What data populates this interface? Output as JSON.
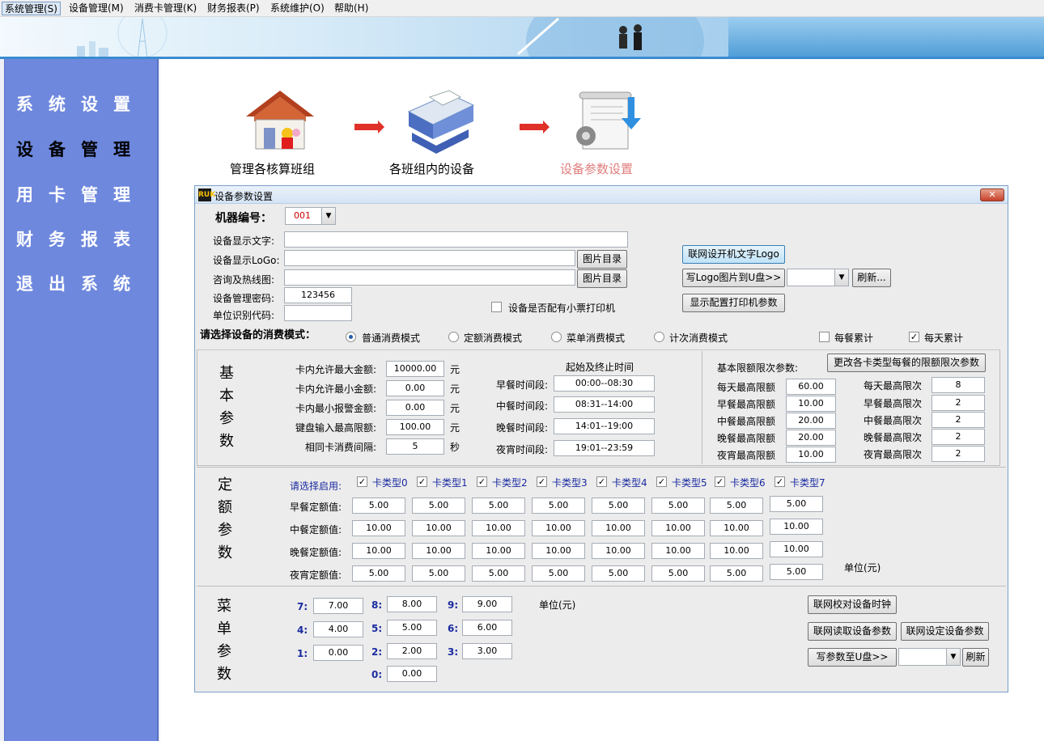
{
  "menu": [
    "系统管理(S)",
    "设备管理(M)",
    "消费卡管理(K)",
    "财务报表(P)",
    "系统维护(O)",
    "帮助(H)"
  ],
  "sidebar": [
    "系统设置",
    "设备管理",
    "用卡管理",
    "财务报表",
    "退出系统"
  ],
  "flow": {
    "step1": "管理各核算班组",
    "step2": "各班组内的设备",
    "step3": "设备参数设置"
  },
  "colors": {
    "sidebar": "#6e88de",
    "active_step": "#e07c7c",
    "accent_blue": "#1a2aa0"
  },
  "window": {
    "title": "设备参数设置",
    "app_icon": "RUK",
    "close": "✕",
    "machine_label": "机器编号：",
    "machine_value": "001",
    "display_text_label": "设备显示文字:",
    "display_text_value": "",
    "logo_label": "设备显示LoGo:",
    "logo_value": "",
    "hotline_label": "咨询及热线图:",
    "hotline_value": "",
    "img_dir_button": "图片目录",
    "password_label": "设备管理密码:",
    "password_value": "123456",
    "unit_code_label": "单位识别代码:",
    "unit_code_value": "",
    "printer_checkbox": "设备是否配有小票打印机",
    "btn_set_logo": "联网设开机文字Logo",
    "btn_write_logo": "写Logo图片到U盘>>",
    "btn_refresh": "刷新...",
    "btn_printer_params": "显示配置打印机参数",
    "mode_label": "请选择设备的消费模式：",
    "modes": [
      "普通消费模式",
      "定额消费模式",
      "菜单消费模式",
      "计次消费模式"
    ],
    "per_meal": "每餐累计",
    "per_day": "每天累计"
  },
  "basic": {
    "title": [
      "基",
      "本",
      "参",
      "数"
    ],
    "rows": [
      {
        "label": "卡内允许最大金额:",
        "value": "10000.00",
        "unit": "元"
      },
      {
        "label": "卡内允许最小金额:",
        "value": "0.00",
        "unit": "元"
      },
      {
        "label": "卡内最小报警金额:",
        "value": "0.00",
        "unit": "元"
      },
      {
        "label": "键盘输入最高限额:",
        "value": "100.00",
        "unit": "元"
      },
      {
        "label": "相同卡消费间隔:",
        "value": "5",
        "unit": "秒"
      }
    ],
    "time_header": "起始及终止时间",
    "times": [
      {
        "label": "早餐时间段:",
        "value": "00:00--08:30"
      },
      {
        "label": "中餐时间段:",
        "value": "08:31--14:00"
      },
      {
        "label": "晚餐时间段:",
        "value": "14:01--19:00"
      },
      {
        "label": "夜宵时间段:",
        "value": "19:01--23:59"
      }
    ],
    "limit_header": "基本限额限次参数:",
    "limit_button": "更改各卡类型每餐的限额限次参数",
    "limits": [
      {
        "label": "每天最高限额",
        "value": "60.00",
        "label2": "每天最高限次",
        "value2": "8"
      },
      {
        "label": "早餐最高限额",
        "value": "10.00",
        "label2": "早餐最高限次",
        "value2": "2"
      },
      {
        "label": "中餐最高限额",
        "value": "20.00",
        "label2": "中餐最高限次",
        "value2": "2"
      },
      {
        "label": "晚餐最高限额",
        "value": "20.00",
        "label2": "晚餐最高限次",
        "value2": "2"
      },
      {
        "label": "夜宵最高限额",
        "value": "10.00",
        "label2": "夜宵最高限次",
        "value2": "2"
      }
    ]
  },
  "fixed": {
    "title": [
      "定",
      "额",
      "参",
      "数"
    ],
    "enable_label": "请选择启用:",
    "card_types": [
      "卡类型0",
      "卡类型1",
      "卡类型2",
      "卡类型3",
      "卡类型4",
      "卡类型5",
      "卡类型6",
      "卡类型7"
    ],
    "rows": [
      {
        "label": "早餐定额值:",
        "values": [
          "5.00",
          "5.00",
          "5.00",
          "5.00",
          "5.00",
          "5.00",
          "5.00",
          "5.00"
        ]
      },
      {
        "label": "中餐定额值:",
        "values": [
          "10.00",
          "10.00",
          "10.00",
          "10.00",
          "10.00",
          "10.00",
          "10.00",
          "10.00"
        ]
      },
      {
        "label": "晚餐定额值:",
        "values": [
          "10.00",
          "10.00",
          "10.00",
          "10.00",
          "10.00",
          "10.00",
          "10.00",
          "10.00"
        ]
      },
      {
        "label": "夜宵定额值:",
        "values": [
          "5.00",
          "5.00",
          "5.00",
          "5.00",
          "5.00",
          "5.00",
          "5.00",
          "5.00"
        ]
      }
    ],
    "unit": "单位(元)"
  },
  "menu_params": {
    "title": [
      "菜",
      "单",
      "参",
      "数"
    ],
    "keys": [
      {
        "key": "7:",
        "value": "7.00"
      },
      {
        "key": "8:",
        "value": "8.00"
      },
      {
        "key": "9:",
        "value": "9.00"
      },
      {
        "key": "4:",
        "value": "4.00"
      },
      {
        "key": "5:",
        "value": "5.00"
      },
      {
        "key": "6:",
        "value": "6.00"
      },
      {
        "key": "1:",
        "value": "0.00"
      },
      {
        "key": "2:",
        "value": "2.00"
      },
      {
        "key": "3:",
        "value": "3.00"
      },
      {
        "key": "0:",
        "value": "0.00"
      }
    ],
    "unit": "单位(元)",
    "btn_sync_clock": "联网校对设备时钟",
    "btn_read": "联网读取设备参数",
    "btn_set": "联网设定设备参数",
    "btn_write_u": "写参数至U盘>>",
    "btn_refresh": "刷新"
  }
}
